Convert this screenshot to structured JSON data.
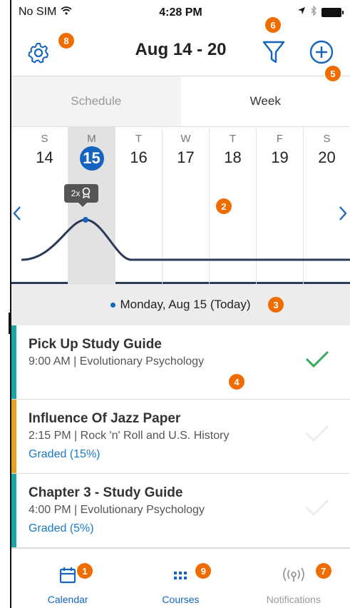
{
  "status_bar": {
    "carrier": "No SIM",
    "time": "4:28 PM"
  },
  "header": {
    "title": "Aug 14 - 20"
  },
  "segments": [
    {
      "label": "Schedule"
    },
    {
      "label": "Week"
    }
  ],
  "week": {
    "days": [
      {
        "dow": "S",
        "num": "14"
      },
      {
        "dow": "M",
        "num": "15"
      },
      {
        "dow": "T",
        "num": "16"
      },
      {
        "dow": "W",
        "num": "17"
      },
      {
        "dow": "T",
        "num": "18"
      },
      {
        "dow": "F",
        "num": "19"
      },
      {
        "dow": "S",
        "num": "20"
      }
    ],
    "tooltip": "2x"
  },
  "date_header": "Monday, Aug 15 (Today)",
  "tasks": [
    {
      "title": "Pick Up Study Guide",
      "meta": "9:00 AM | Evolutionary Psychology",
      "graded": "",
      "color": "#1aa6a6",
      "done": true
    },
    {
      "title": "Influence Of Jazz Paper",
      "meta": "2:15 PM | Rock 'n' Roll and U.S. History",
      "graded": "Graded (15%)",
      "color": "#e8a11c",
      "done": false
    },
    {
      "title": "Chapter 3 - Study Guide",
      "meta": "4:00 PM | Evolutionary Psychology",
      "graded": "Graded (5%)",
      "color": "#1aa6a6",
      "done": false
    }
  ],
  "tabbar": [
    {
      "label": "Calendar"
    },
    {
      "label": "Courses"
    },
    {
      "label": "Notifications"
    }
  ],
  "badges": {
    "b1": "1",
    "b2": "2",
    "b3": "3",
    "b4": "4",
    "b5": "5",
    "b6": "6",
    "b7": "7",
    "b8": "8",
    "b9": "9"
  },
  "colors": {
    "accent": "#1565c0",
    "badge": "#ef6c00",
    "check": "#3aa85a"
  }
}
